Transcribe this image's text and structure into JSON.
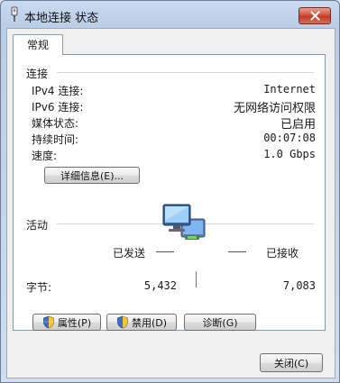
{
  "window": {
    "title": "本地连接 状态"
  },
  "tab": {
    "label": "常规"
  },
  "connection": {
    "heading": "连接",
    "rows": [
      {
        "label": "IPv4 连接:",
        "value": "Internet"
      },
      {
        "label": "IPv6 连接:",
        "value": "无网络访问权限"
      },
      {
        "label": "媒体状态:",
        "value": "已启用"
      },
      {
        "label": "持续时间:",
        "value": "00:07:08"
      },
      {
        "label": "速度:",
        "value": "1.0 Gbps"
      }
    ],
    "details_button": "详细信息(E)..."
  },
  "activity": {
    "heading": "活动",
    "sent_label": "已发送",
    "received_label": "已接收",
    "bytes_label": "字节:",
    "bytes_sent": "5,432",
    "bytes_received": "7,083"
  },
  "buttons": {
    "properties": "属性(P)",
    "disable": "禁用(D)",
    "diagnose": "诊断(G)",
    "close": "关闭(C)"
  }
}
